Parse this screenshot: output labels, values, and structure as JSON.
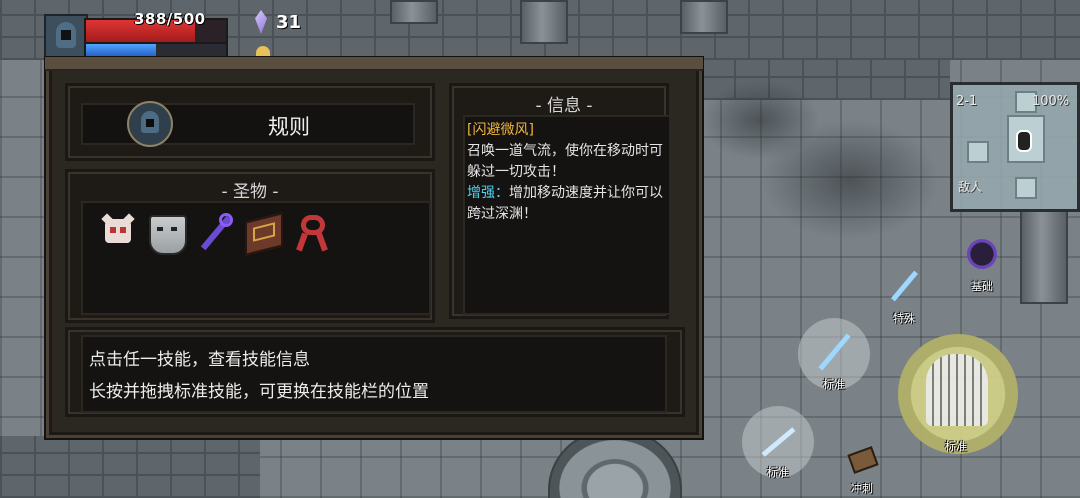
{
  "hud": {
    "hp_text": "388/500",
    "hp_fraction": 0.776,
    "mp_fraction": 0.5,
    "crystal_count": "31",
    "icons": {
      "avatar": "hooded-hero-icon",
      "crystal": "crystal-icon",
      "coin": "coin-icon"
    }
  },
  "panel": {
    "rule_title": "规则",
    "relics_title": "- 圣物 -",
    "relics": [
      "skull-relic-icon",
      "mask-relic-icon",
      "staff-relic-icon",
      "book-relic-icon",
      "ribbon-relic-icon"
    ],
    "info_title": "- 信息 -",
    "info_skill_name": "[闪避微风]",
    "info_desc": "召唤一道气流，使你在移动时可躲过一切攻击！",
    "info_enh_label": "增强：",
    "info_enh_text": "增加移动速度并让你可以跨过深渊！",
    "help_line1": "点击任一技能，查看技能信息",
    "help_line2": "长按并拖拽标准技能，可更换在技能栏的位置"
  },
  "minimap": {
    "level": "2-1",
    "percent": "100%",
    "enemy_label": "敌人"
  },
  "skills": {
    "basic": "基础",
    "special": "特殊",
    "standard_1": "标准",
    "standard_main": "标准",
    "standard_2": "标准",
    "dash": "冲刺"
  },
  "colors": {
    "panel_bg": "#2b2721",
    "hp": "#e03434",
    "mp": "#4fa4ff",
    "skill_name": "#f0b53b",
    "enhance_label": "#4fd3f0"
  }
}
